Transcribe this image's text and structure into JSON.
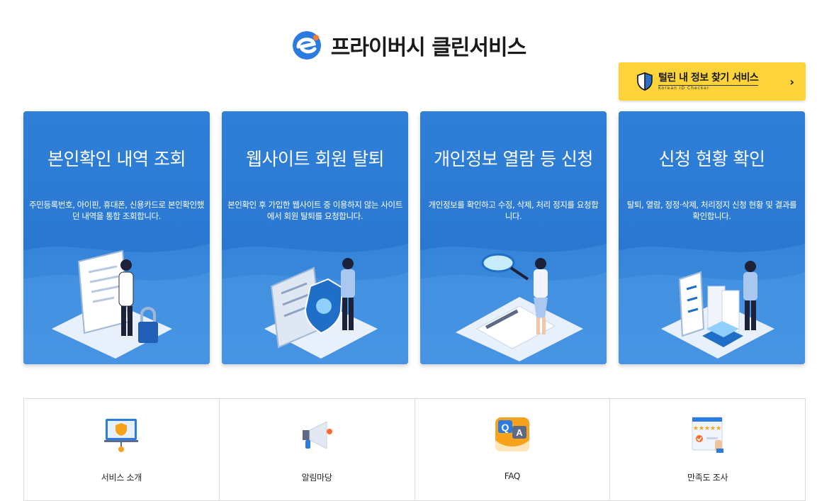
{
  "header": {
    "logo_icon": "e-logo-icon",
    "title": "프라이버시 클린서비스"
  },
  "leak_check": {
    "label": "털린 내 정보 찾기 서비스",
    "sub": "Korean ID Checker",
    "arrow": "›",
    "icon": "shield-icon"
  },
  "cards": [
    {
      "title": "본인확인 내역 조회",
      "desc": "주민등록번호, 아이핀, 휴대폰, 신용카드로 본인확인했던 내역을 통합 조회합니다.",
      "icon": "document-lock-illustration"
    },
    {
      "title": "웹사이트 회원 탈퇴",
      "desc": "본인확인 후 가입한 웹사이트 중 이용하지 않는 사이트에서 회원 탈퇴를 요청합니다.",
      "icon": "laptop-shield-illustration"
    },
    {
      "title": "개인정보 열람 등 신청",
      "desc": "개인정보를 확인하고 수정, 삭제, 처리 정지를 요청합니다.",
      "icon": "magnifier-illustration"
    },
    {
      "title": "신청 현황 확인",
      "desc": "탈퇴, 열람, 정정·삭제, 처리정지 신청 현황 및 결과를 확인합니다.",
      "icon": "checklist-illustration"
    }
  ],
  "menu": [
    {
      "label": "서비스 소개",
      "icon": "presentation-icon"
    },
    {
      "label": "알림마당",
      "icon": "megaphone-icon"
    },
    {
      "label": "FAQ",
      "icon": "qa-icon"
    },
    {
      "label": "만족도 조사",
      "icon": "rating-icon"
    }
  ],
  "colors": {
    "card_blue": "#2a78d2",
    "leak_yellow": "#fcd43a",
    "logo_blue": "#2b7be0"
  }
}
